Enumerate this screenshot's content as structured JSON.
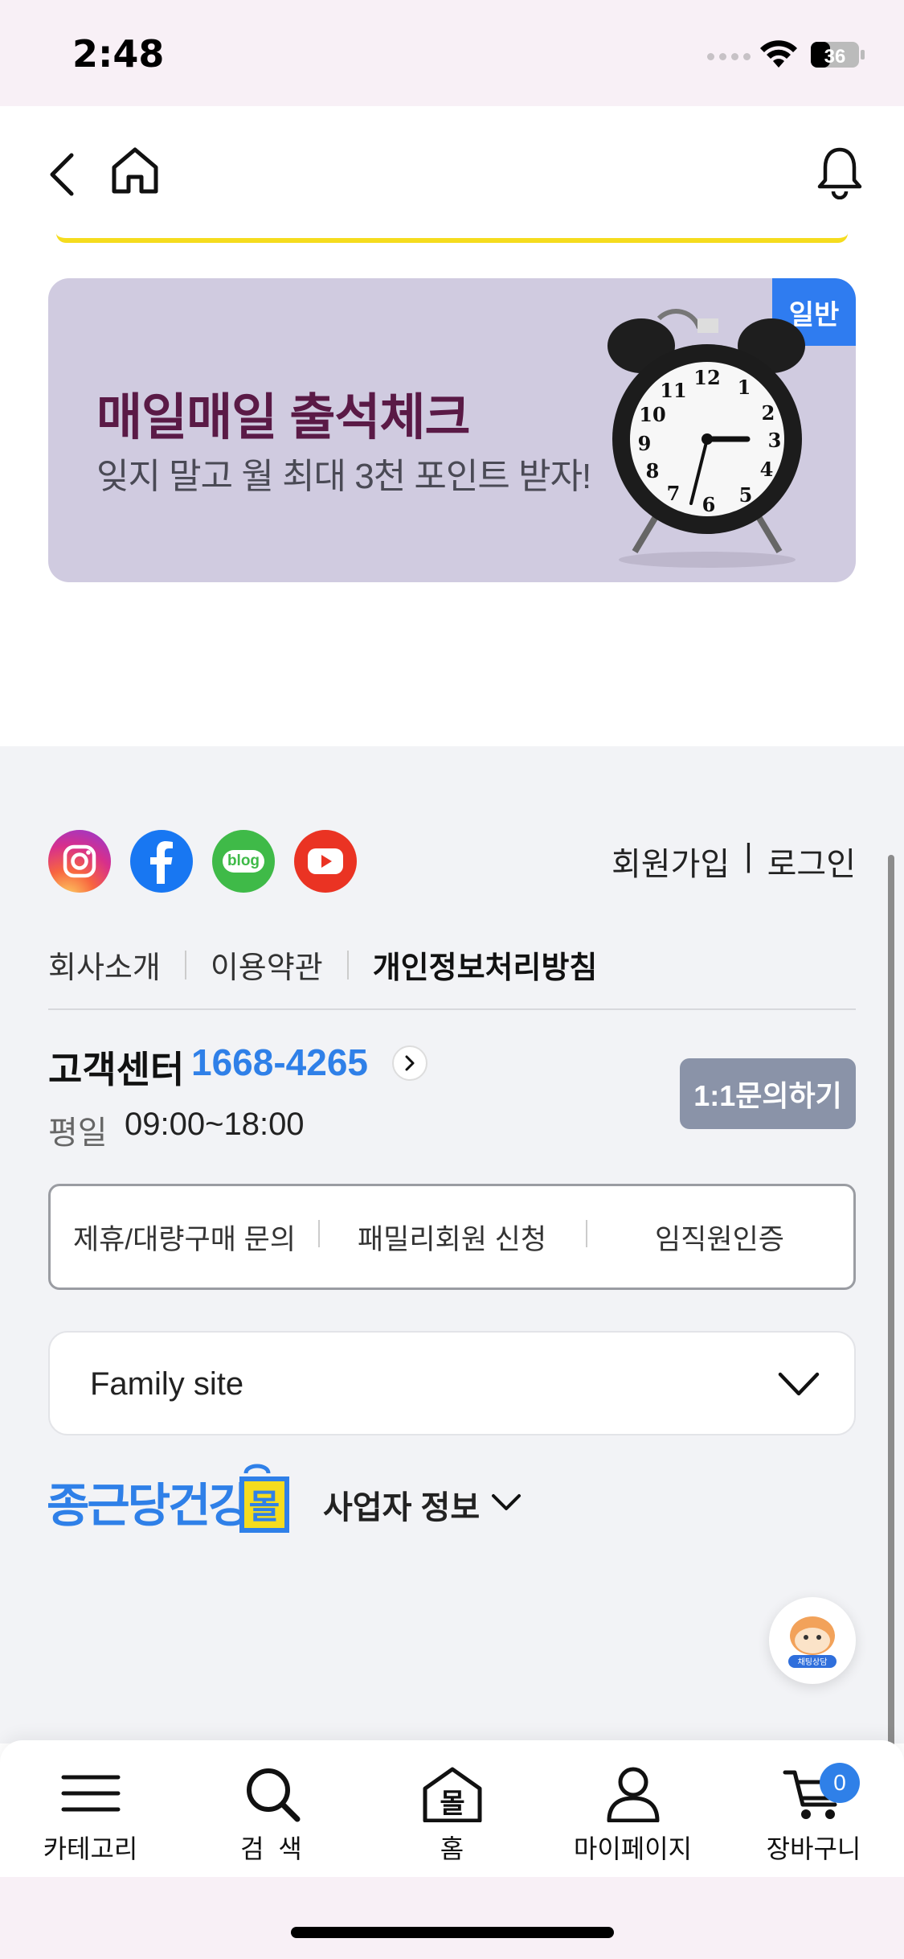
{
  "status": {
    "time": "2:48",
    "battery": "36"
  },
  "banner": {
    "tag": "일반",
    "title": "매일매일 출석체크",
    "subtitle": "잊지 말고 월 최대 3천 포인트 받자!"
  },
  "footer": {
    "auth": {
      "signup": "회원가입",
      "separator": "|",
      "login": "로그인"
    },
    "policy_links": [
      "회사소개",
      "이용약관",
      "개인정보처리방침"
    ],
    "customer_center": {
      "label": "고객센터",
      "phone": "1668-4265",
      "hours_label": "평일",
      "hours": "09:00~18:00",
      "inquiry_button": "1:1문의하기"
    },
    "partner_links": [
      "제휴/대량구매 문의",
      "패밀리회원 신청",
      "임직원인증"
    ],
    "family_site": "Family site",
    "brand": {
      "text": "종근당건강",
      "mall_char": "몰"
    },
    "business_info": "사업자 정보",
    "chat_label": "채팅상담"
  },
  "tabbar": {
    "items": [
      "카테고리",
      "검  색",
      "홈",
      "마이페이지",
      "장바구니"
    ],
    "home_icon_char": "몰",
    "cart_count": "0"
  },
  "icons": {
    "social": [
      "instagram-icon",
      "facebook-icon",
      "blog-icon",
      "youtube-icon"
    ],
    "social_text": {
      "blog": "blog"
    }
  },
  "colors": {
    "accent": "#2f80e8",
    "banner_bg": "#d0cbe0",
    "banner_title": "#5a1a46",
    "tag": "#2f7cf0",
    "inquiry": "#8a93a8"
  }
}
